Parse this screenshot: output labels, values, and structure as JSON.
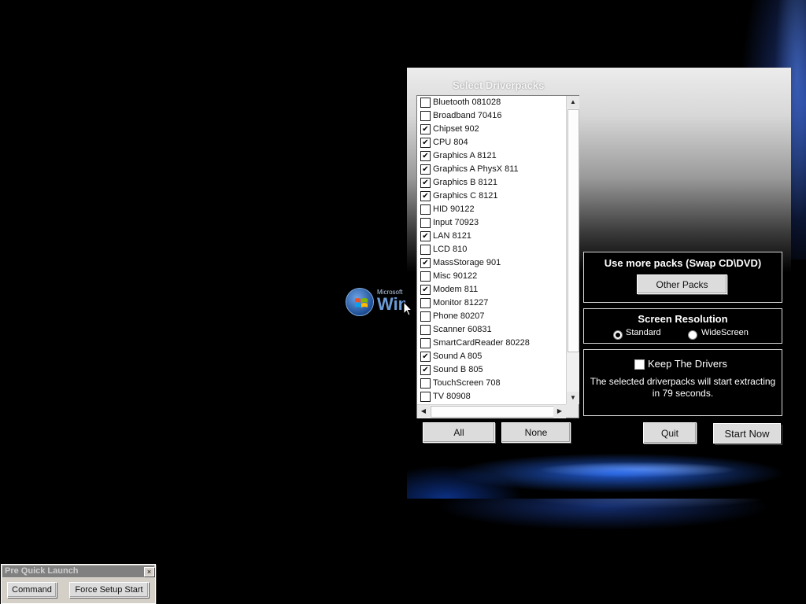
{
  "desktop": {
    "logo_microsoft": "Microsoft",
    "logo_windows": "Windows"
  },
  "driverpacks": {
    "title": "Select Driverpacks",
    "items": [
      {
        "label": "Bluetooth 081028",
        "checked": false
      },
      {
        "label": "Broadband 70416",
        "checked": false
      },
      {
        "label": "Chipset 902",
        "checked": true
      },
      {
        "label": "CPU 804",
        "checked": true
      },
      {
        "label": "Graphics A 8121",
        "checked": true
      },
      {
        "label": "Graphics A PhysX 811",
        "checked": true
      },
      {
        "label": "Graphics B 8121",
        "checked": true
      },
      {
        "label": "Graphics C 8121",
        "checked": true
      },
      {
        "label": "HID 90122",
        "checked": false
      },
      {
        "label": "Input 70923",
        "checked": false
      },
      {
        "label": "LAN 8121",
        "checked": true
      },
      {
        "label": "LCD 810",
        "checked": false
      },
      {
        "label": "MassStorage 901",
        "checked": true
      },
      {
        "label": "Misc 90122",
        "checked": false
      },
      {
        "label": "Modem 811",
        "checked": true
      },
      {
        "label": "Monitor 81227",
        "checked": false
      },
      {
        "label": "Phone 80207",
        "checked": false
      },
      {
        "label": "Scanner 60831",
        "checked": false
      },
      {
        "label": "SmartCardReader 80228",
        "checked": false
      },
      {
        "label": "Sound A 805",
        "checked": true
      },
      {
        "label": "Sound B 805",
        "checked": true
      },
      {
        "label": "TouchScreen 708",
        "checked": false
      },
      {
        "label": "TV 80908",
        "checked": false
      }
    ],
    "check_mark": "✔",
    "all_label": "All",
    "none_label": "None"
  },
  "more_packs": {
    "title": "Use more packs (Swap CD\\DVD)",
    "button_label": "Other Packs"
  },
  "resolution": {
    "title": "Screen Resolution",
    "options": [
      {
        "label": "Standard",
        "selected": true
      },
      {
        "label": "WideScreen",
        "selected": false
      }
    ]
  },
  "keep_drivers": {
    "label": "Keep The Drivers",
    "checked": false,
    "message": "The selected driverpacks will start extracting in 79 seconds."
  },
  "actions": {
    "quit_label": "Quit",
    "start_label": "Start Now"
  },
  "quick_launch": {
    "title": "Pre Quick Launch",
    "close_label": "×",
    "command_label": "Command",
    "force_setup_label": "Force Setup Start"
  }
}
